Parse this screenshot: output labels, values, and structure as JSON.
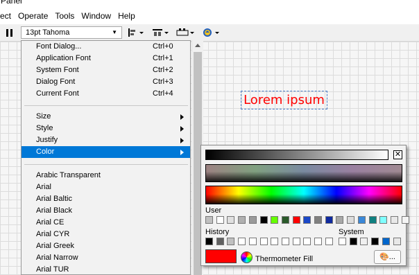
{
  "title_fragment": "Panel",
  "menubar": [
    "ect",
    "Operate",
    "Tools",
    "Window",
    "Help"
  ],
  "toolbar": {
    "font_select": "13pt Tahoma",
    "align_icon": "align-objects-icon",
    "distribute_icon": "distribute-objects-icon",
    "resize_icon": "resize-objects-icon",
    "reorder_icon": "reorder-icon"
  },
  "canvas": {
    "label_text": "Lorem ipsum",
    "label_color": "#ff0000"
  },
  "font_menu": {
    "group1": [
      {
        "label": "Font Dialog...",
        "shortcut": "Ctrl+0"
      },
      {
        "label": "Application Font",
        "shortcut": "Ctrl+1"
      },
      {
        "label": "System Font",
        "shortcut": "Ctrl+2"
      },
      {
        "label": "Dialog Font",
        "shortcut": "Ctrl+3"
      },
      {
        "label": "Current Font",
        "shortcut": "Ctrl+4"
      }
    ],
    "group2": [
      {
        "label": "Size"
      },
      {
        "label": "Style"
      },
      {
        "label": "Justify"
      },
      {
        "label": "Color",
        "highlighted": true
      }
    ],
    "fonts": [
      "Arabic Transparent",
      "Arial",
      "Arial Baltic",
      "Arial Black",
      "Arial CE",
      "Arial CYR",
      "Arial Greek",
      "Arial Narrow",
      "Arial TUR"
    ]
  },
  "palette": {
    "user_label": "User",
    "history_label": "History",
    "system_label": "System",
    "user_colors": [
      "#c0c0c0",
      "#ffffff",
      "#e0e0e0",
      "#b0b0b0",
      "#9a9a9a",
      "#000000",
      "#66ff00",
      "#2a5a2a",
      "#ff0000",
      "#1a48c8",
      "#808080",
      "#0f2aa0",
      "#a8a8a8",
      "#dcdcdc",
      "#3a88d8",
      "#108080",
      "#80ffff",
      "#e8e8e8",
      "#f4f4f4"
    ],
    "history_colors": [
      "#000000",
      "#606060",
      "#c0c0c0",
      "#ffffff",
      "#ffffff",
      "#ffffff",
      "#ffffff",
      "#ffffff",
      "#ffffff",
      "#ffffff",
      "#ffffff",
      "#ffffff"
    ],
    "system_colors": [
      "#ffffff",
      "#000000",
      "#f0f0f0",
      "#000000",
      "#0066cc",
      "#e8e8e8"
    ],
    "selected_color": "#ff0000",
    "selected_label": "Thermometer Fill",
    "more_button": "..."
  }
}
